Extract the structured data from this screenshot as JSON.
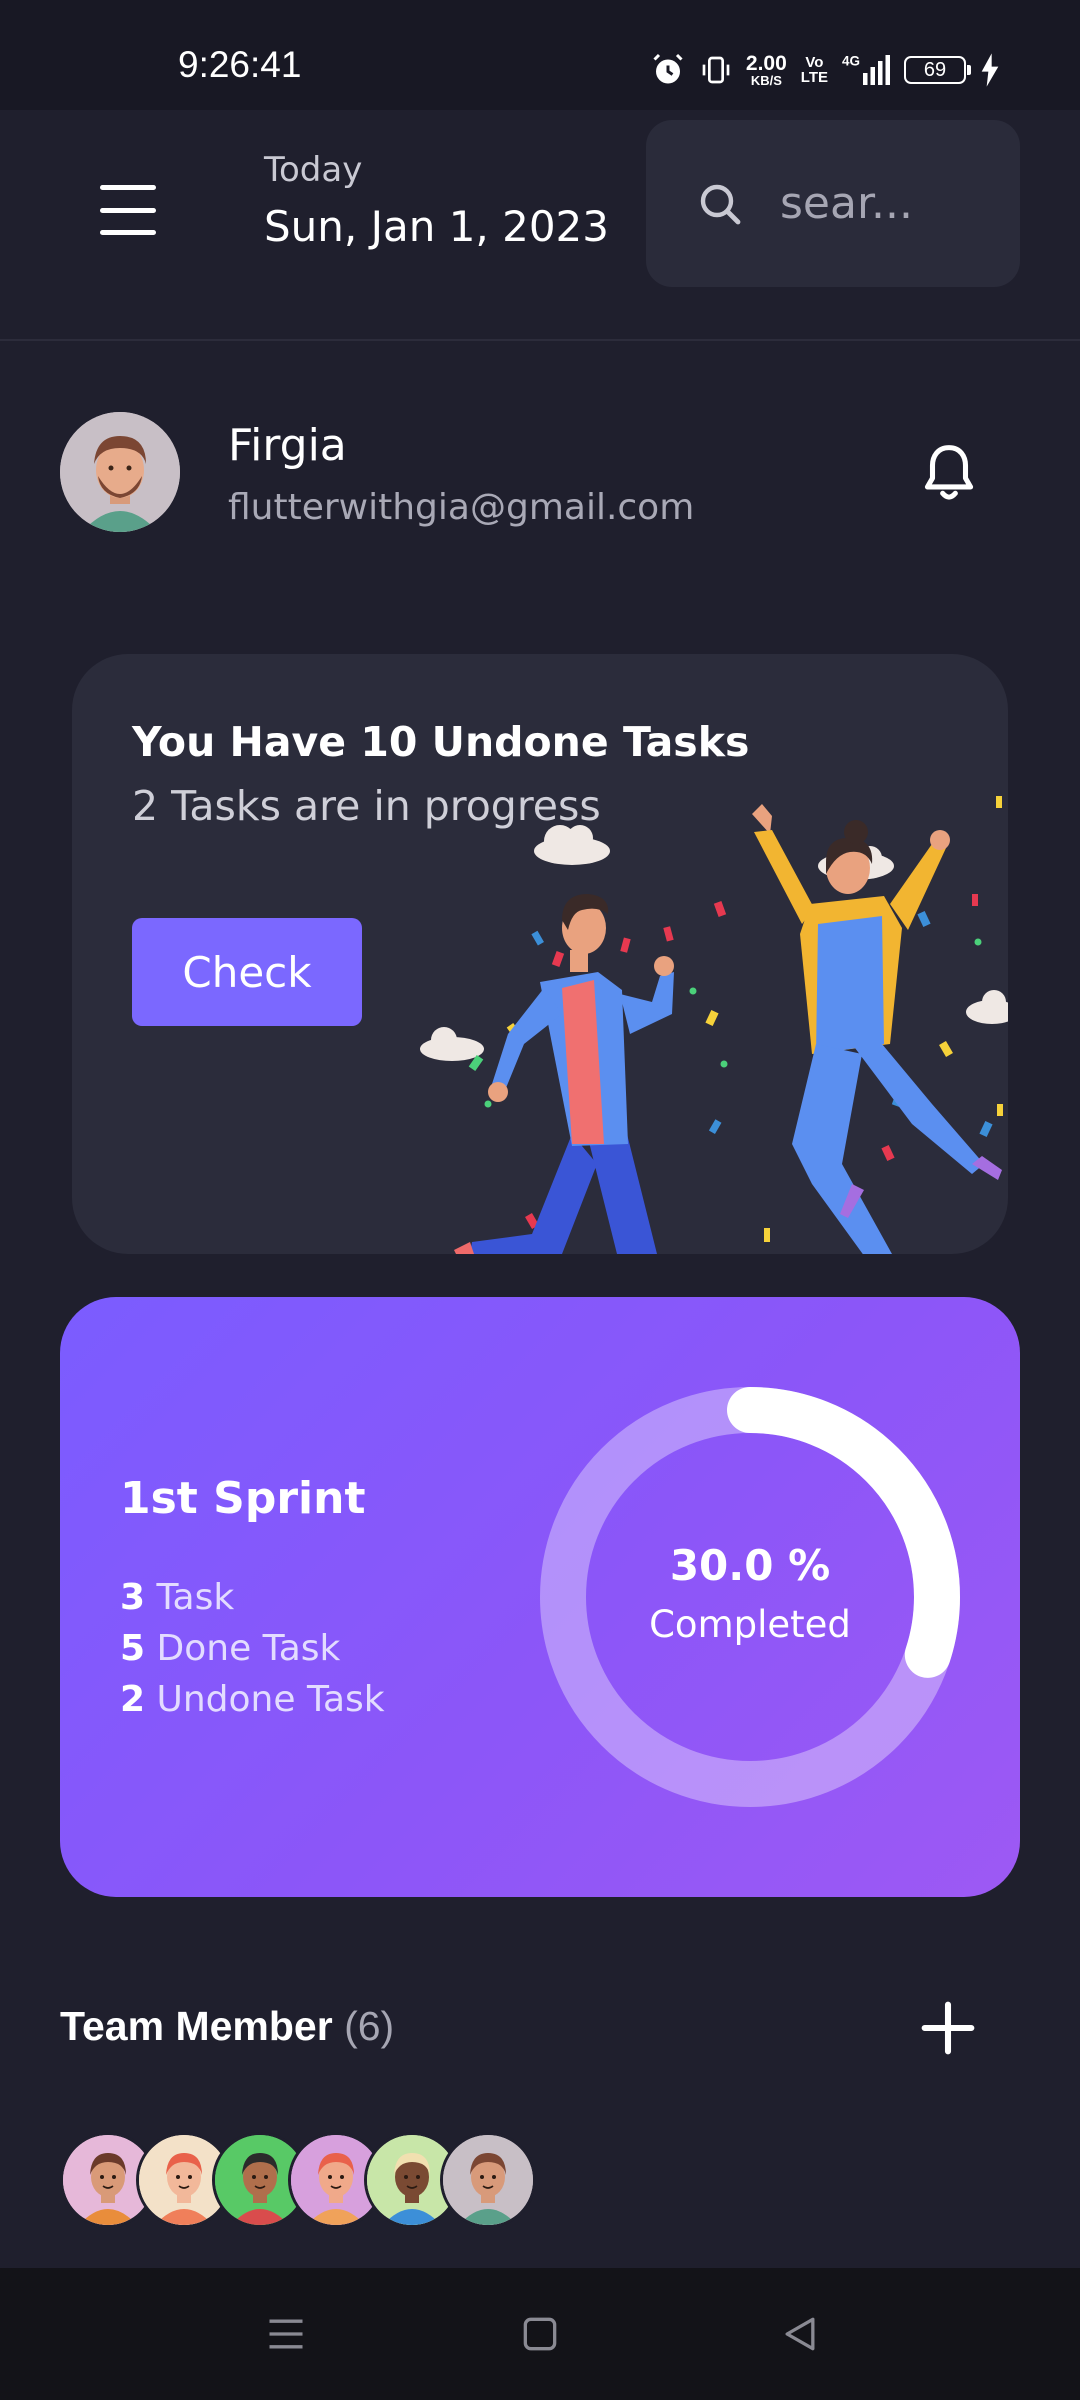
{
  "status_bar": {
    "time": "9:26:41",
    "speed_value": "2.00",
    "speed_unit": "KB/S",
    "volte_top": "Vo",
    "volte_bottom": "LTE",
    "network": "4G",
    "battery": "69"
  },
  "header": {
    "menu_icon": "hamburger-menu-icon",
    "today_label": "Today",
    "date": "Sun, Jan 1, 2023",
    "search_placeholder": "sear...",
    "search_icon": "search-icon"
  },
  "profile": {
    "name": "Firgia",
    "email": "flutterwithgia@gmail.com",
    "bell_icon": "bell-icon"
  },
  "tasks_card": {
    "title": "You Have 10 Undone Tasks",
    "subtitle": "2 Tasks are in progress",
    "button_label": "Check"
  },
  "sprint_card": {
    "title": "1st Sprint",
    "lines": [
      {
        "count": "3",
        "label": " Task"
      },
      {
        "count": "5",
        "label": " Done Task"
      },
      {
        "count": "2",
        "label": " Undone Task"
      }
    ],
    "percent_text": "30.0 %",
    "percent_value": 0.3,
    "completed_label": "Completed"
  },
  "team": {
    "title": "Team Member",
    "count": "(6)",
    "add_icon": "plus-icon",
    "members": [
      {
        "bg": "#e6b8d9",
        "skin": "#d99a78",
        "hair": "#6b3a2a",
        "shirt": "#e98d3b"
      },
      {
        "bg": "#f3e1c8",
        "skin": "#f2b89a",
        "hair": "#e9614a",
        "shirt": "#f07f5a"
      },
      {
        "bg": "#58c966",
        "skin": "#b06f4c",
        "hair": "#2b2b2b",
        "shirt": "#d94c4c"
      },
      {
        "bg": "#d7a0dd",
        "skin": "#f0a98a",
        "hair": "#e9614a",
        "shirt": "#f0a25a"
      },
      {
        "bg": "#c8e6a8",
        "skin": "#7a4a33",
        "hair": "#f1e0b0",
        "shirt": "#3c8fd8"
      },
      {
        "bg": "#c8bfc6",
        "skin": "#d89a7a",
        "hair": "#7b4633",
        "shirt": "#5aa08a"
      }
    ]
  },
  "colors": {
    "background": "#1f1f2d",
    "card": "#2b2c3b",
    "accent": "#7b68ff"
  },
  "nav_bar": {
    "recent_icon": "recent-apps-icon",
    "home_icon": "home-icon",
    "back_icon": "back-icon"
  }
}
